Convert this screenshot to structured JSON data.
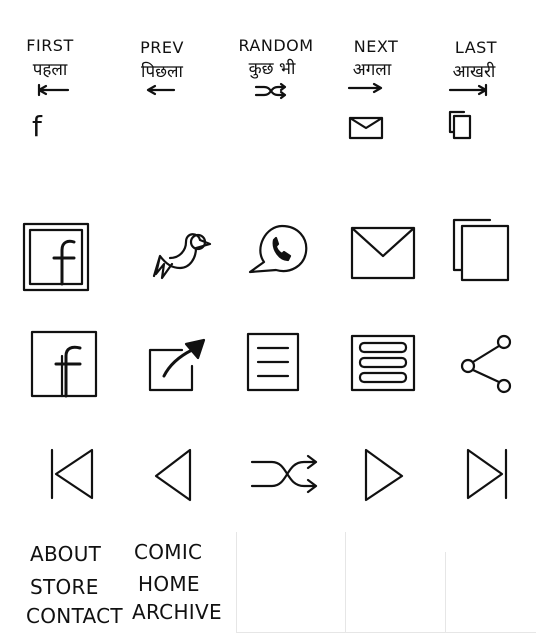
{
  "nav": [
    {
      "label": "FIRST",
      "hindi": "पहला",
      "icon": "first-arrow-icon"
    },
    {
      "label": "PREV",
      "hindi": "पिछला",
      "icon": "prev-arrow-icon"
    },
    {
      "label": "RANDOM",
      "hindi": "कुछ भी",
      "icon": "shuffle-icon"
    },
    {
      "label": "NEXT",
      "hindi": "अगला",
      "icon": "next-arrow-icon"
    },
    {
      "label": "LAST",
      "hindi": "आखरी",
      "icon": "last-arrow-icon"
    }
  ],
  "links": {
    "about": "ABOUT",
    "store": "STORE",
    "contact": "CONTACT",
    "comic": "COMIC",
    "home": "HOME",
    "archive": "ARCHIVE"
  },
  "small_icons": {
    "facebook": "f"
  }
}
